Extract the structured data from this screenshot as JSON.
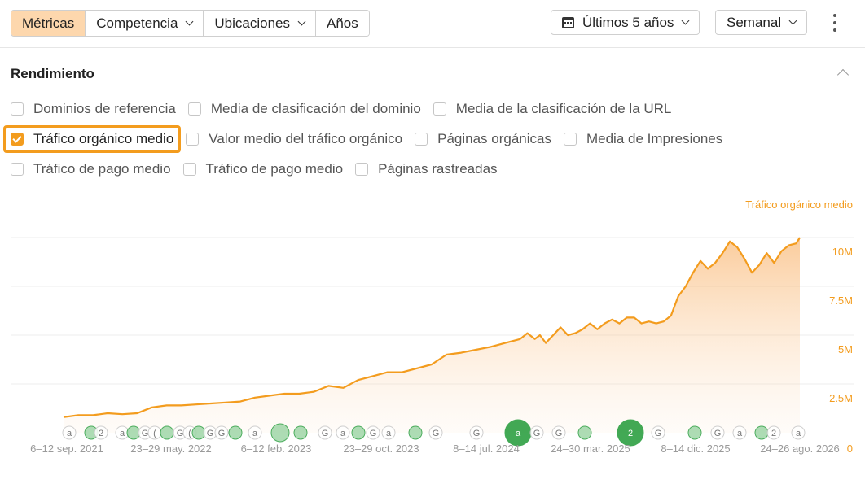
{
  "toolbar": {
    "segments": [
      "Métricas",
      "Competencia",
      "Ubicaciones",
      "Años"
    ],
    "date_range": "Últimos 5 años",
    "granularity": "Semanal"
  },
  "section": {
    "title": "Rendimiento",
    "checkboxes": [
      {
        "label": "Dominios de referencia",
        "checked": false
      },
      {
        "label": "Media de clasificación del dominio",
        "checked": false
      },
      {
        "label": "Media de la clasificación de la URL",
        "checked": false
      },
      {
        "label": "Tráfico orgánico medio",
        "checked": true
      },
      {
        "label": "Valor medio del tráfico orgánico",
        "checked": false
      },
      {
        "label": "Páginas orgánicas",
        "checked": false
      },
      {
        "label": "Media de Impresiones",
        "checked": false
      },
      {
        "label": "Tráfico de pago medio",
        "checked": false
      },
      {
        "label": "Tráfico de pago medio",
        "checked": false
      },
      {
        "label": "Páginas rastreadas",
        "checked": false
      }
    ]
  },
  "colors": {
    "accent": "#f39c1e",
    "active_segment": "#fdd7ad",
    "marker_green": "#2ea043"
  },
  "chart_data": {
    "type": "area",
    "series": [
      {
        "name": "Tráfico orgánico medio"
      }
    ],
    "ylabel": "Tráfico orgánico medio",
    "ylim": [
      0,
      10500000
    ],
    "y_ticks": [
      {
        "v": 0,
        "label": "0"
      },
      {
        "v": 2500000,
        "label": "2.5M"
      },
      {
        "v": 5000000,
        "label": "5M"
      },
      {
        "v": 7500000,
        "label": "7.5M"
      },
      {
        "v": 10000000,
        "label": "10M"
      }
    ],
    "x_tick_labels": [
      "6–12 sep. 2021",
      "23–29 may. 2022",
      "6–12 feb. 2023",
      "23–29 oct. 2023",
      "8–14 jul. 2024",
      "24–30 mar. 2025",
      "8–14 dic. 2025",
      "24–26 ago. 2026"
    ],
    "xlim": [
      0,
      100
    ],
    "values": [
      [
        0,
        800000
      ],
      [
        2,
        900000
      ],
      [
        4,
        900000
      ],
      [
        6,
        1000000
      ],
      [
        8,
        950000
      ],
      [
        10,
        1000000
      ],
      [
        12,
        1300000
      ],
      [
        14,
        1400000
      ],
      [
        16,
        1400000
      ],
      [
        18,
        1450000
      ],
      [
        20,
        1500000
      ],
      [
        22,
        1550000
      ],
      [
        24,
        1600000
      ],
      [
        26,
        1800000
      ],
      [
        28,
        1900000
      ],
      [
        30,
        2000000
      ],
      [
        32,
        2000000
      ],
      [
        34,
        2100000
      ],
      [
        36,
        2400000
      ],
      [
        38,
        2300000
      ],
      [
        40,
        2700000
      ],
      [
        42,
        2900000
      ],
      [
        44,
        3100000
      ],
      [
        46,
        3100000
      ],
      [
        48,
        3300000
      ],
      [
        50,
        3500000
      ],
      [
        52,
        4000000
      ],
      [
        54,
        4100000
      ],
      [
        56,
        4250000
      ],
      [
        58,
        4400000
      ],
      [
        60,
        4600000
      ],
      [
        62,
        4800000
      ],
      [
        63,
        5100000
      ],
      [
        64,
        4800000
      ],
      [
        64.7,
        5000000
      ],
      [
        65.5,
        4600000
      ],
      [
        66.5,
        5000000
      ],
      [
        67.5,
        5400000
      ],
      [
        68.5,
        5000000
      ],
      [
        69.5,
        5100000
      ],
      [
        70.5,
        5300000
      ],
      [
        71.5,
        5600000
      ],
      [
        72.5,
        5300000
      ],
      [
        73.5,
        5600000
      ],
      [
        74.5,
        5800000
      ],
      [
        75.5,
        5600000
      ],
      [
        76.5,
        5900000
      ],
      [
        77.5,
        5900000
      ],
      [
        78.5,
        5600000
      ],
      [
        79.5,
        5700000
      ],
      [
        80.5,
        5600000
      ],
      [
        81.5,
        5700000
      ],
      [
        82.5,
        6000000
      ],
      [
        83.5,
        7000000
      ],
      [
        84.5,
        7500000
      ],
      [
        85.5,
        8200000
      ],
      [
        86.5,
        8800000
      ],
      [
        87.5,
        8400000
      ],
      [
        88.5,
        8700000
      ],
      [
        89.5,
        9200000
      ],
      [
        90.5,
        9800000
      ],
      [
        91.5,
        9500000
      ],
      [
        92.5,
        8900000
      ],
      [
        93.5,
        8200000
      ],
      [
        94.5,
        8600000
      ],
      [
        95.5,
        9200000
      ],
      [
        96.5,
        8700000
      ],
      [
        97.5,
        9300000
      ],
      [
        98.5,
        9600000
      ],
      [
        99.5,
        9700000
      ],
      [
        100,
        10000000
      ]
    ]
  }
}
